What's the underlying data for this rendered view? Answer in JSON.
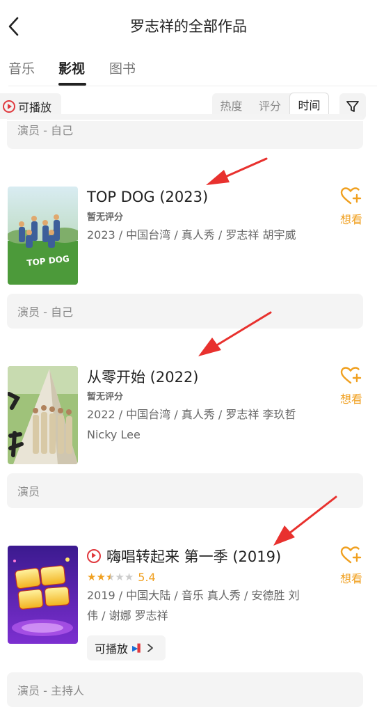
{
  "header": {
    "title": "罗志祥的全部作品"
  },
  "tabs": [
    {
      "label": "音乐",
      "active": false
    },
    {
      "label": "影视",
      "active": true
    },
    {
      "label": "图书",
      "active": false
    }
  ],
  "filters": {
    "playable_label": "可播放",
    "sort_options": [
      "热度",
      "评分",
      "时间"
    ],
    "selected_sort": "时间"
  },
  "top_role": "演员 - 自己",
  "works": [
    {
      "title": "TOP DOG (2023)",
      "rating_text": "暂无评分",
      "meta": "2023 / 中国台湾 / 真人秀 / 罗志祥 胡宇威",
      "role": "演员 - 自己",
      "want_label": "想看"
    },
    {
      "title": "从零开始 (2022)",
      "rating_text": "暂无评分",
      "meta": "2022 / 中国台湾 / 真人秀 / 罗志祥 李玖哲 Nicky Lee",
      "role": "演员",
      "want_label": "想看"
    },
    {
      "title": "嗨唱转起来 第一季 (2019)",
      "playable": true,
      "stars": 2.5,
      "score": "5.4",
      "meta": "2019 / 中国大陆 / 音乐 真人秀 / 安德胜 刘伟 / 谢娜 罗志祥",
      "play_chip_label": "可播放",
      "role": "演员 - 主持人",
      "want_label": "想看"
    }
  ],
  "icons": {
    "back": "chevron-left-icon",
    "filter": "funnel-icon",
    "want": "heart-plus-icon",
    "play": "play-circle-icon"
  },
  "colors": {
    "accent": "#f0a020",
    "play_red": "#e0393e",
    "annotation_arrow": "#e8312e"
  }
}
